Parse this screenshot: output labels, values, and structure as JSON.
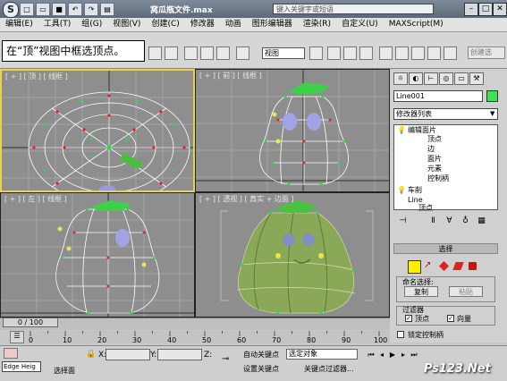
{
  "window": {
    "title": "窝瓜瓶文件.max",
    "search_placeholder": "键入关键字或短语",
    "min_label": "–",
    "max_label": "□",
    "close_label": "✕"
  },
  "menu": [
    "编辑(E)",
    "工具(T)",
    "组(G)",
    "视图(V)",
    "创建(C)",
    "修改器",
    "动画",
    "图形编辑器",
    "渲染(R)",
    "自定义(U)",
    "MAXScript(M)"
  ],
  "tooltip": "在“顶”视图中框选顶点。",
  "toolbar": {
    "view_select": "视图",
    "create_selection": "创建选"
  },
  "viewports": {
    "top": "[ + ] [ 顶 ] [ 线框 ]",
    "front": "[ + ] [ 前 ] [ 线框 ]",
    "left": "[ + ] [ 左 ] [ 线框 ]",
    "persp": "[ + ] [ 透视 ] [ 真实 + 边面 ]"
  },
  "panel": {
    "object_name": "Line001",
    "modifier_list": "修改器列表",
    "stack": {
      "edit_patch": "编辑面片",
      "vertex": "顶点",
      "edge": "边",
      "patch": "面片",
      "element": "元素",
      "handle": "控制柄",
      "lathe": "车削",
      "line": "Line",
      "line_sub": "顶点"
    },
    "rollout": "选择",
    "named_sel_title": "命名选择:",
    "copy": "复制",
    "paste": "粘贴",
    "filter_title": "过滤器",
    "vertices": "顶点",
    "vectors": "向量",
    "lock_handles": "锁定控制柄"
  },
  "timeline": {
    "slider": "0 / 100",
    "ticks": [
      "0",
      "10",
      "20",
      "30",
      "40",
      "50",
      "60",
      "70",
      "80",
      "90",
      "100"
    ]
  },
  "status": {
    "maxscript": "Edge Heig",
    "message": "选择面",
    "x_label": "X:",
    "y_label": "Y:",
    "z_label": "Z:",
    "autokey": "自动关键点",
    "selected_object": "选定对象",
    "setkey": "设置关键点",
    "keyfilter": "关键点过滤器..."
  },
  "colors": {
    "active_viewport": "#e7d44a",
    "object_color": "#3fe05a",
    "vertex_highlight": "#ffff00"
  },
  "watermark": "Ps123.Net"
}
